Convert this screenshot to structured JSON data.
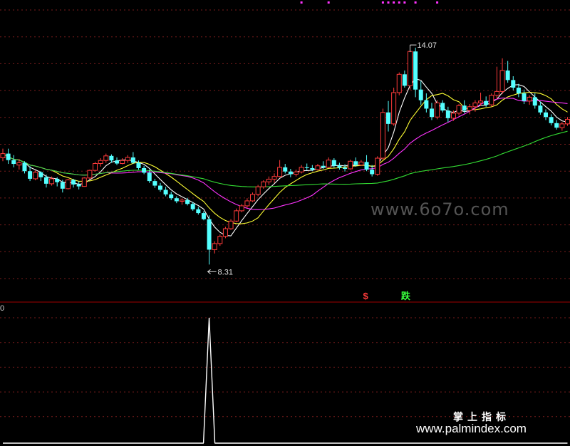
{
  "chart_data": {
    "type": "candlestick",
    "price_range": [
      7.4,
      15.1
    ],
    "grid": true,
    "up_color": "#ff3b3b",
    "down_color": "#54ffff",
    "ma_colors": [
      "#ffffff",
      "#ffff33",
      "#ff33ff",
      "#33dd33"
    ],
    "candles": [
      [
        11.11,
        11.35,
        11.02,
        11.22
      ],
      [
        11.22,
        11.35,
        10.95,
        11.05
      ],
      [
        11.05,
        11.18,
        10.86,
        10.95
      ],
      [
        10.92,
        11.08,
        10.8,
        10.98
      ],
      [
        10.98,
        11.02,
        10.7,
        10.76
      ],
      [
        10.76,
        10.89,
        10.5,
        10.56
      ],
      [
        10.56,
        10.78,
        10.52,
        10.73
      ],
      [
        10.73,
        10.76,
        10.5,
        10.6
      ],
      [
        10.6,
        10.67,
        10.33,
        10.43
      ],
      [
        10.43,
        10.62,
        10.38,
        10.56
      ],
      [
        10.56,
        10.6,
        10.36,
        10.47
      ],
      [
        10.47,
        10.53,
        10.2,
        10.3
      ],
      [
        10.3,
        10.56,
        10.28,
        10.53
      ],
      [
        10.53,
        10.56,
        10.33,
        10.41
      ],
      [
        10.41,
        10.49,
        10.28,
        10.36
      ],
      [
        10.36,
        10.6,
        10.35,
        10.58
      ],
      [
        10.58,
        10.8,
        10.55,
        10.78
      ],
      [
        10.78,
        11.0,
        10.75,
        10.96
      ],
      [
        10.96,
        11.1,
        10.88,
        11.04
      ],
      [
        11.04,
        11.22,
        10.98,
        11.16
      ],
      [
        11.16,
        11.2,
        10.98,
        11.04
      ],
      [
        11.04,
        11.12,
        10.92,
        10.96
      ],
      [
        10.96,
        11.1,
        10.94,
        11.04
      ],
      [
        11.04,
        11.18,
        10.98,
        11.12
      ],
      [
        11.12,
        11.26,
        10.95,
        10.98
      ],
      [
        10.98,
        11.04,
        10.8,
        10.84
      ],
      [
        10.84,
        10.9,
        10.68,
        10.72
      ],
      [
        10.72,
        10.8,
        10.45,
        10.5
      ],
      [
        10.5,
        10.56,
        10.32,
        10.38
      ],
      [
        10.38,
        10.45,
        10.22,
        10.27
      ],
      [
        10.27,
        10.35,
        10.1,
        10.15
      ],
      [
        10.15,
        10.22,
        10.0,
        10.05
      ],
      [
        10.05,
        10.1,
        9.92,
        9.97
      ],
      [
        9.97,
        10.05,
        9.88,
        10.0
      ],
      [
        10.0,
        10.06,
        9.86,
        9.9
      ],
      [
        9.9,
        9.95,
        9.72,
        9.76
      ],
      [
        9.76,
        9.82,
        9.62,
        9.66
      ],
      [
        9.66,
        9.71,
        9.47,
        9.5
      ],
      [
        9.5,
        9.6,
        8.31,
        8.7
      ],
      [
        8.7,
        8.92,
        8.6,
        8.86
      ],
      [
        8.86,
        9.1,
        8.8,
        9.05
      ],
      [
        9.05,
        9.3,
        9.0,
        9.25
      ],
      [
        9.25,
        9.5,
        9.22,
        9.45
      ],
      [
        9.45,
        9.78,
        9.42,
        9.72
      ],
      [
        9.72,
        9.9,
        9.68,
        9.85
      ],
      [
        9.85,
        10.05,
        9.8,
        9.98
      ],
      [
        9.98,
        10.2,
        9.95,
        10.15
      ],
      [
        10.15,
        10.4,
        10.1,
        10.35
      ],
      [
        10.35,
        10.52,
        10.3,
        10.48
      ],
      [
        10.48,
        10.62,
        10.4,
        10.55
      ],
      [
        10.55,
        10.7,
        10.45,
        10.62
      ],
      [
        10.62,
        11.05,
        10.6,
        10.86
      ],
      [
        10.86,
        10.95,
        10.7,
        10.75
      ],
      [
        10.75,
        10.82,
        10.6,
        10.68
      ],
      [
        10.68,
        10.8,
        10.62,
        10.74
      ],
      [
        10.74,
        10.92,
        10.7,
        10.86
      ],
      [
        10.86,
        10.96,
        10.78,
        10.84
      ],
      [
        10.84,
        10.92,
        10.76,
        10.8
      ],
      [
        10.8,
        10.95,
        10.78,
        10.9
      ],
      [
        10.9,
        11.02,
        10.82,
        10.86
      ],
      [
        10.86,
        11.12,
        10.84,
        11.05
      ],
      [
        11.05,
        11.1,
        10.85,
        10.9
      ],
      [
        10.9,
        10.98,
        10.8,
        10.85
      ],
      [
        10.85,
        10.94,
        10.75,
        10.82
      ],
      [
        10.82,
        11.06,
        10.8,
        11.02
      ],
      [
        11.02,
        11.12,
        10.88,
        10.92
      ],
      [
        10.92,
        11.05,
        10.9,
        11.0
      ],
      [
        11.0,
        11.18,
        10.76,
        10.8
      ],
      [
        10.8,
        10.92,
        10.62,
        10.68
      ],
      [
        10.68,
        11.15,
        10.64,
        11.1
      ],
      [
        11.1,
        12.4,
        11.05,
        12.3
      ],
      [
        12.3,
        12.6,
        11.8,
        12.0
      ],
      [
        12.0,
        12.95,
        11.95,
        12.82
      ],
      [
        12.82,
        13.35,
        12.75,
        13.3
      ],
      [
        13.3,
        13.4,
        12.95,
        13.0
      ],
      [
        13.0,
        14.07,
        12.9,
        13.9
      ],
      [
        13.9,
        14.0,
        12.7,
        12.9
      ],
      [
        12.9,
        13.12,
        12.5,
        12.62
      ],
      [
        12.62,
        12.8,
        12.3,
        12.4
      ],
      [
        12.4,
        12.55,
        12.1,
        12.18
      ],
      [
        12.18,
        12.62,
        12.12,
        12.55
      ],
      [
        12.55,
        12.62,
        12.3,
        12.35
      ],
      [
        12.35,
        12.45,
        12.05,
        12.15
      ],
      [
        12.15,
        12.35,
        12.08,
        12.28
      ],
      [
        12.28,
        12.52,
        12.22,
        12.48
      ],
      [
        12.48,
        12.62,
        12.28,
        12.35
      ],
      [
        12.35,
        12.52,
        12.25,
        12.45
      ],
      [
        12.45,
        12.62,
        12.32,
        12.55
      ],
      [
        12.55,
        12.82,
        12.48,
        12.6
      ],
      [
        12.6,
        12.72,
        12.45,
        12.5
      ],
      [
        12.5,
        12.8,
        12.45,
        12.75
      ],
      [
        12.75,
        13.5,
        12.65,
        12.85
      ],
      [
        12.85,
        13.72,
        12.78,
        13.4
      ],
      [
        13.4,
        13.65,
        13.08,
        13.15
      ],
      [
        13.15,
        13.25,
        12.88,
        12.95
      ],
      [
        12.95,
        13.05,
        12.7,
        12.8
      ],
      [
        12.8,
        12.9,
        12.52,
        12.6
      ],
      [
        12.6,
        12.75,
        12.5,
        12.7
      ],
      [
        12.7,
        12.8,
        12.4,
        12.48
      ],
      [
        12.48,
        12.58,
        12.24,
        12.3
      ],
      [
        12.3,
        12.38,
        12.1,
        12.18
      ],
      [
        12.18,
        12.25,
        11.96,
        12.02
      ],
      [
        12.02,
        12.1,
        11.85,
        11.9
      ],
      [
        11.9,
        12.05,
        11.82,
        12.0
      ],
      [
        12.0,
        12.18,
        11.95,
        12.12
      ]
    ],
    "ma_series": [
      {
        "period": 5,
        "color": "#ffffff"
      },
      {
        "period": 10,
        "color": "#ffff33"
      },
      {
        "period": 20,
        "color": "#ff33ff"
      },
      {
        "period": 60,
        "color": "#33dd33"
      }
    ],
    "annotations": [
      {
        "label": "14.07",
        "index": 75,
        "price": 14.07,
        "type": "high"
      },
      {
        "label": "8.31",
        "index": 38,
        "price": 8.31,
        "type": "low"
      }
    ],
    "signals": [
      {
        "index": 67,
        "label": "$",
        "color": "#ff3b3b"
      },
      {
        "index": 74,
        "label": "跌",
        "color": "#39ff3d"
      }
    ],
    "top_markers": [
      55,
      60,
      70,
      71,
      72,
      73,
      74,
      76,
      80
    ],
    "indicator": {
      "axis_label": "0",
      "range": [
        0,
        1
      ],
      "values": [
        0,
        0,
        0,
        0,
        0,
        0,
        0,
        0,
        0,
        0,
        0,
        0,
        0,
        0,
        0,
        0,
        0,
        0,
        0,
        0,
        0,
        0,
        0,
        0,
        0,
        0,
        0,
        0,
        0,
        0,
        0,
        0,
        0,
        0,
        0,
        0,
        0,
        0,
        1,
        0,
        0,
        0,
        0,
        0,
        0,
        0,
        0,
        0,
        0,
        0,
        0,
        0,
        0,
        0,
        0,
        0,
        0,
        0,
        0,
        0,
        0,
        0,
        0,
        0,
        0,
        0,
        0,
        0,
        0,
        0,
        0,
        0,
        0,
        0,
        0,
        0,
        0,
        0,
        0,
        0,
        0,
        0,
        0,
        0,
        0,
        0,
        0,
        0,
        0,
        0,
        0,
        0,
        0,
        0,
        0,
        0,
        0,
        0,
        0,
        0,
        0,
        0,
        0,
        0,
        0
      ]
    }
  },
  "watermarks": {
    "site_top": "www.6o7o.com",
    "brand_cn": "掌上指标",
    "site_bottom": "www.palmindex.com"
  }
}
